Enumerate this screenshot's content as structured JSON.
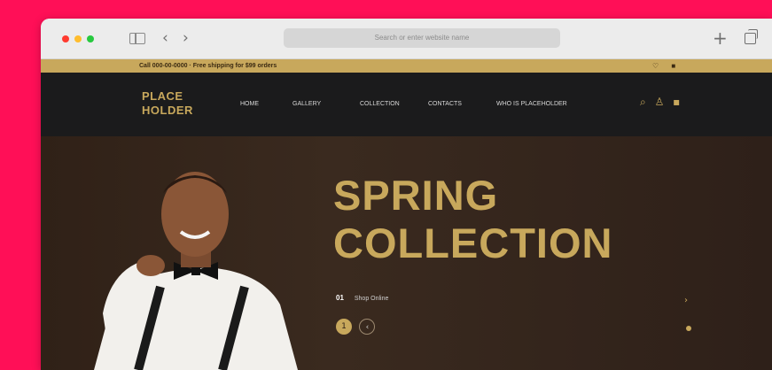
{
  "browser": {
    "address_placeholder": "Search or enter website name",
    "back_icon": "chevron-left-icon",
    "forward_icon": "chevron-right-icon",
    "new_tab_icon": "plus-icon",
    "tabs_icon": "tabs-overview-icon"
  },
  "topbar": {
    "contact": "Call 000-00-0000 · Free shipping for $99 orders",
    "icons": [
      "heart-icon",
      "user-icon"
    ]
  },
  "nav": {
    "logo_line1": "PLACE",
    "logo_line2": "HOLDER",
    "links": [
      "HOME",
      "GALLERY",
      "COLLECTION",
      "CONTACTS",
      "WHO IS PLACEHOLDER"
    ],
    "icons": [
      "search-icon",
      "user-icon",
      "cart-icon"
    ]
  },
  "hero": {
    "title_line1": "SPRING",
    "title_line2": "COLLECTION",
    "meta_tag": "01",
    "meta_text": "Shop Online",
    "slide_active": "1",
    "slide_next": "‹"
  },
  "colors": {
    "accent": "#c8a85c",
    "background": "#ff0f57",
    "nav_bg": "#1b1b1c",
    "hero_bg": "#2d1f17"
  }
}
